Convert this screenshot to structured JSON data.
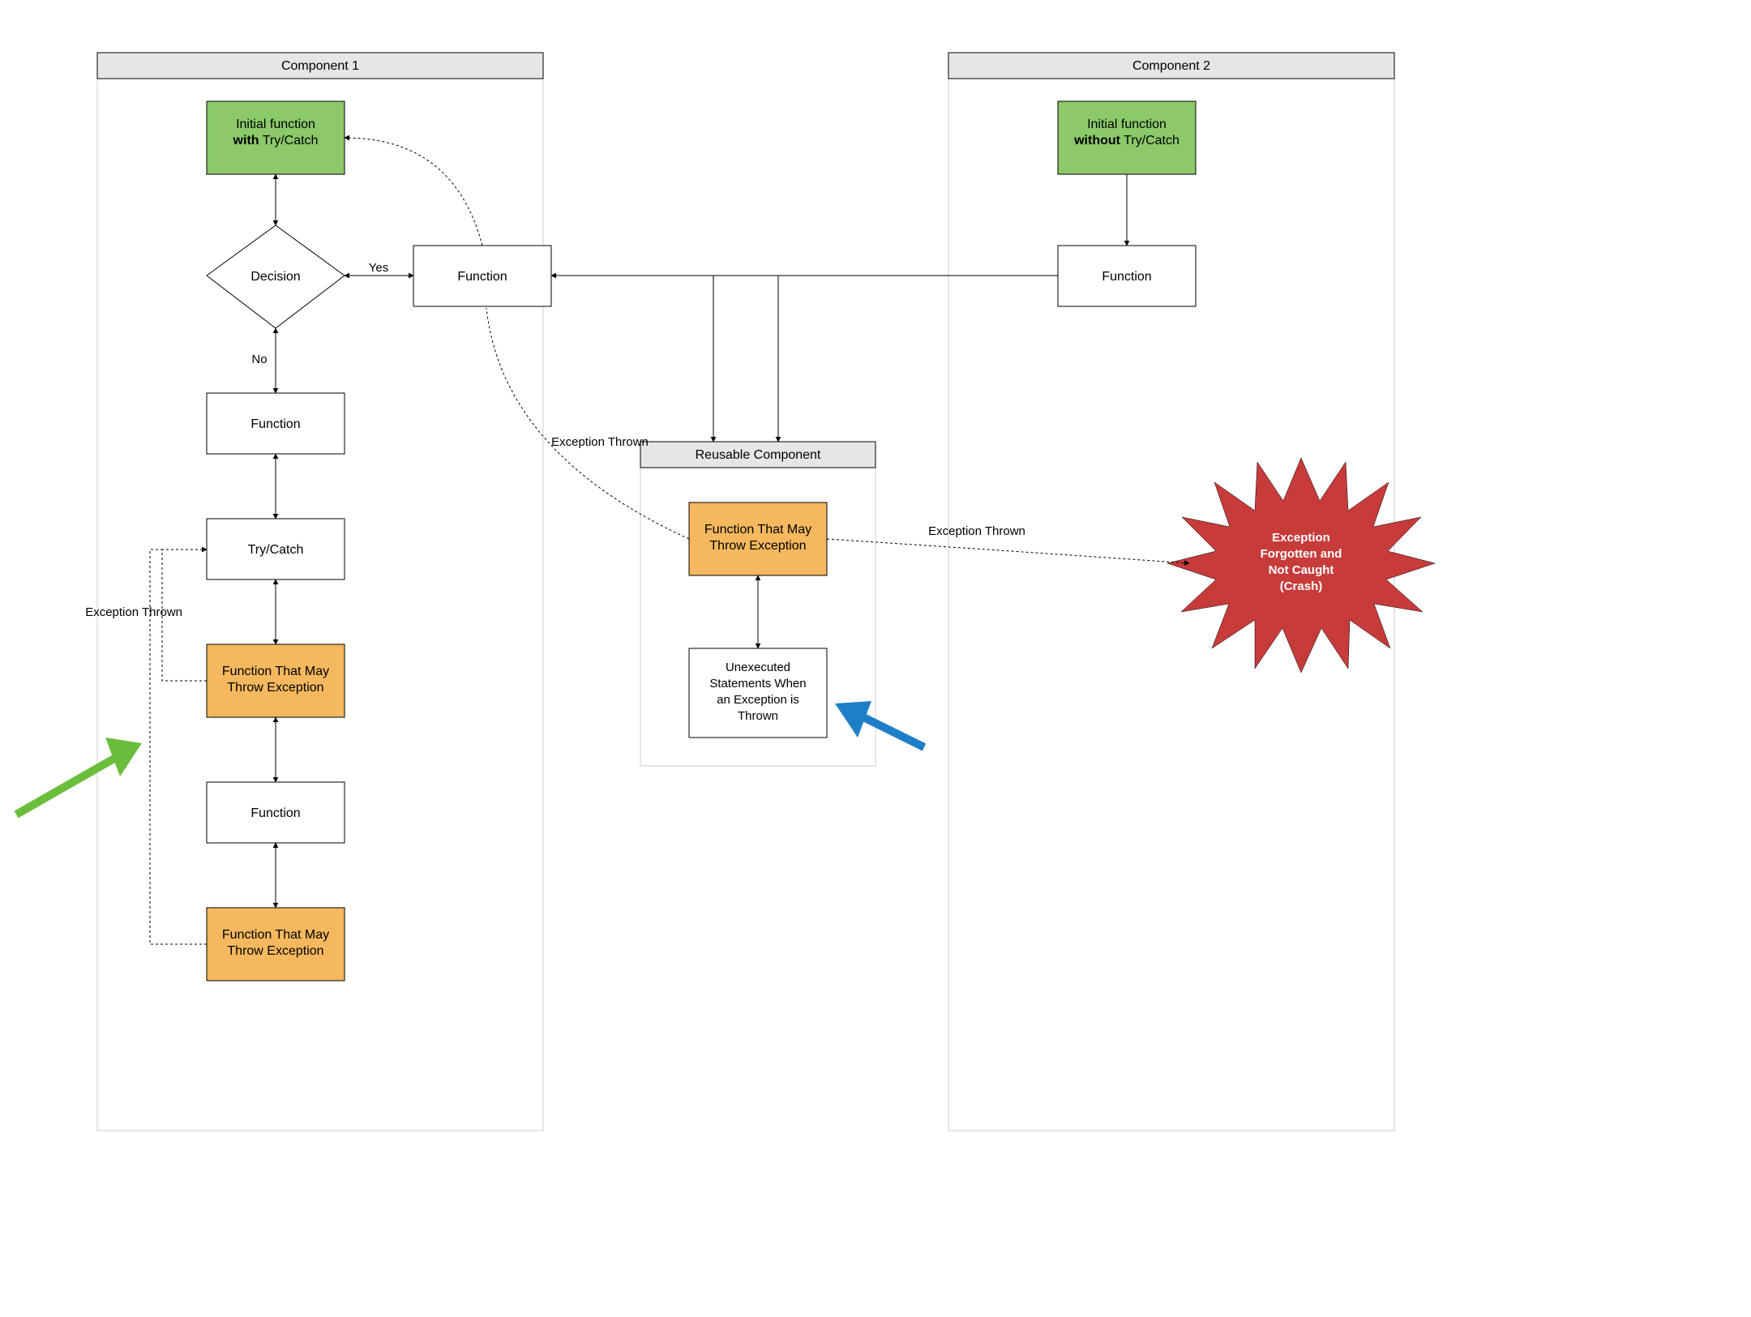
{
  "chart_data": {
    "type": "flowchart",
    "components": [
      {
        "id": "component1",
        "title": "Component 1",
        "nodes": [
          {
            "id": "c1_start",
            "type": "start",
            "label_lines": [
              "Initial function",
              "with",
              " Try/Catch"
            ],
            "bold_word": "with"
          },
          {
            "id": "c1_decision",
            "type": "decision",
            "label": "Decision"
          },
          {
            "id": "c1_func_right",
            "type": "process",
            "label": "Function"
          },
          {
            "id": "c1_func_no",
            "type": "process",
            "label": "Function"
          },
          {
            "id": "c1_trycatch",
            "type": "process",
            "label": "Try/Catch"
          },
          {
            "id": "c1_fmay1",
            "type": "process_warn",
            "label": "Function That May Throw Exception"
          },
          {
            "id": "c1_func2",
            "type": "process",
            "label": "Function"
          },
          {
            "id": "c1_fmay2",
            "type": "process_warn",
            "label": "Function That May Throw Exception"
          }
        ],
        "edges": [
          {
            "from": "c1_start",
            "to": "c1_decision",
            "style": "solid",
            "bidir": true
          },
          {
            "from": "c1_decision",
            "to": "c1_func_right",
            "style": "solid",
            "bidir": true,
            "label": "Yes"
          },
          {
            "from": "c1_decision",
            "to": "c1_func_no",
            "style": "solid",
            "bidir": true,
            "label": "No"
          },
          {
            "from": "c1_func_no",
            "to": "c1_trycatch",
            "style": "solid",
            "bidir": true
          },
          {
            "from": "c1_trycatch",
            "to": "c1_fmay1",
            "style": "solid",
            "bidir": true
          },
          {
            "from": "c1_fmay1",
            "to": "c1_func2",
            "style": "solid",
            "bidir": true
          },
          {
            "from": "c1_func2",
            "to": "c1_fmay2",
            "style": "solid",
            "bidir": true
          },
          {
            "from": "c1_fmay1",
            "to": "c1_trycatch",
            "style": "dotted",
            "label": "Exception Thrown"
          },
          {
            "from": "c1_fmay2",
            "to": "c1_trycatch",
            "style": "dotted"
          },
          {
            "from": "c1_func_right",
            "to": "c1_start",
            "style": "dotted",
            "label": "Exception Thrown"
          }
        ]
      },
      {
        "id": "reusable",
        "title": "Reusable Component",
        "nodes": [
          {
            "id": "re_fmay",
            "type": "process_warn",
            "label": "Function That May Throw Exception"
          },
          {
            "id": "re_unexec",
            "type": "process",
            "label": "Unexecuted Statements When an Exception is Thrown"
          }
        ],
        "edges": [
          {
            "from": "re_fmay",
            "to": "re_unexec",
            "style": "solid",
            "bidir": true
          }
        ]
      },
      {
        "id": "component2",
        "title": "Component 2",
        "nodes": [
          {
            "id": "c2_start",
            "type": "start",
            "label_lines": [
              "Initial function",
              "without",
              " Try/Catch"
            ],
            "bold_word": "without"
          },
          {
            "id": "c2_func",
            "type": "process",
            "label": "Function"
          }
        ],
        "edges": [
          {
            "from": "c2_start",
            "to": "c2_func",
            "style": "solid",
            "bidir": false
          }
        ]
      }
    ],
    "cross_edges": [
      {
        "from": "c1_func_right",
        "to": "re_fmay",
        "style": "solid"
      },
      {
        "from": "c2_func",
        "to": "c1_func_right",
        "style": "solid",
        "via": "horizontal"
      },
      {
        "from": "c2_func_path",
        "to": "re_fmay",
        "style": "solid"
      },
      {
        "from": "re_fmay",
        "to": "crash",
        "style": "dotted",
        "label": "Exception Thrown"
      }
    ],
    "terminal": {
      "id": "crash",
      "type": "starburst",
      "label": "Exception Forgotten and Not Caught (Crash)"
    },
    "annotations": [
      {
        "type": "arrow",
        "color": "#6BBE3D",
        "points_to": "c1_fmay1"
      },
      {
        "type": "arrow",
        "color": "#1E7FC9",
        "points_to": "re_unexec"
      }
    ]
  },
  "labels": {
    "component1": "Component 1",
    "component2": "Component 2",
    "reusable": "Reusable Component",
    "initial_with_1": "Initial function",
    "with": "with",
    "initial_with_2": " Try/Catch",
    "initial_without_1": "Initial function",
    "without": "without",
    "initial_without_2": " Try/Catch",
    "decision": "Decision",
    "function": "Function",
    "trycatch": "Try/Catch",
    "fmay_l1": "Function That May",
    "fmay_l2": "Throw Exception",
    "unexec_l1": "Unexecuted",
    "unexec_l2": "Statements When",
    "unexec_l3": "an Exception is",
    "unexec_l4": "Thrown",
    "yes": "Yes",
    "no": "No",
    "exception_thrown": "Exception Thrown",
    "crash_l1": "Exception",
    "crash_l2": "Forgotten and",
    "crash_l3": "Not Caught",
    "crash_l4": "(Crash)"
  }
}
